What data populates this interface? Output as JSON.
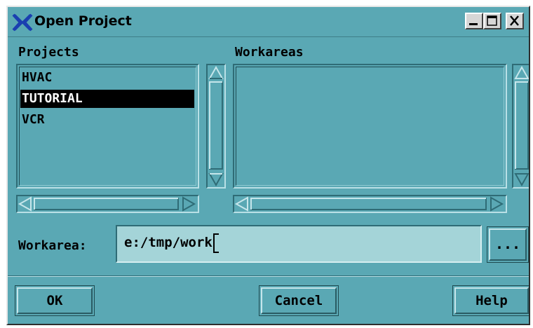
{
  "window": {
    "title": "Open Project",
    "controls": {
      "minimize": "minimize-icon",
      "maximize": "maximize-icon",
      "close": "close-icon"
    }
  },
  "projects": {
    "label": "Projects",
    "items": [
      "HVAC",
      "TUTORIAL",
      "VCR"
    ],
    "selected": "TUTORIAL"
  },
  "workareas": {
    "label": "Workareas",
    "items": []
  },
  "workarea_field": {
    "label": "Workarea:",
    "value": "e:/tmp/work",
    "browse_label": "..."
  },
  "buttons": {
    "ok": "OK",
    "cancel": "Cancel",
    "help": "Help"
  },
  "colors": {
    "dialog_background": "#5aa8b4",
    "input_background": "#a4d4d8",
    "selection": "#000000"
  }
}
